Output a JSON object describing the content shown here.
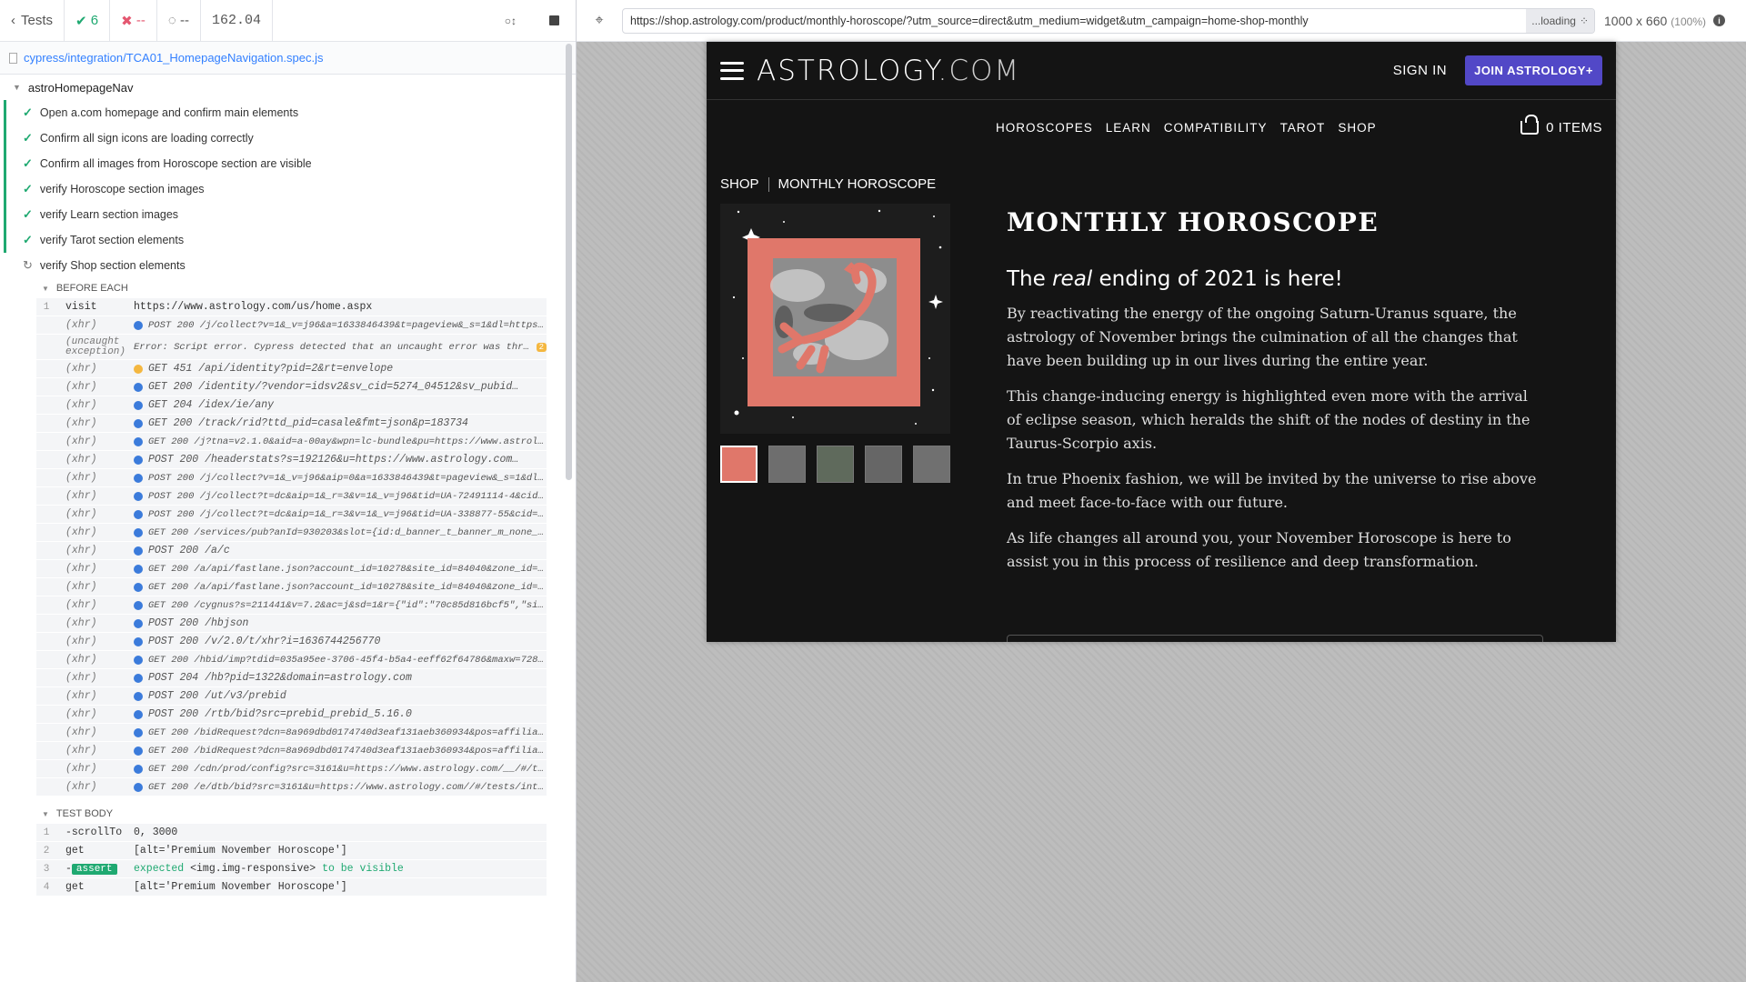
{
  "reporter": {
    "tests_label": "Tests",
    "passed": "6",
    "failed": "--",
    "pending": "--",
    "duration": "162.04",
    "spec_file": "cypress/integration/TCA01_HomepageNavigation.spec.js",
    "suite": "astroHomepageNav",
    "tests": [
      {
        "title": "Open a.com homepage and confirm main elements",
        "state": "passed"
      },
      {
        "title": "Confirm all sign icons are loading correctly",
        "state": "passed"
      },
      {
        "title": "Confirm all images from Horoscope section are visible",
        "state": "passed"
      },
      {
        "title": "verify Horoscope section images",
        "state": "passed"
      },
      {
        "title": "verify Learn section images",
        "state": "passed"
      },
      {
        "title": "verify Tarot section elements",
        "state": "passed"
      },
      {
        "title": "verify Shop section elements",
        "state": "running"
      }
    ],
    "before_each_label": "BEFORE EACH",
    "test_body_label": "TEST BODY",
    "before_each_cmds": [
      {
        "num": "1",
        "name": "visit",
        "msg": "https://www.astrology.com/us/home.aspx",
        "type": "plain"
      },
      {
        "name": "(xhr)",
        "msg": "POST 200 /j/collect?v=1&_v=j96&a=1633846439&t=pageview&_s=1&dl=https:…",
        "type": "small"
      },
      {
        "name": "(uncaught exception)",
        "msg": "Error: Script error. Cypress detected that an uncaught error was throw…",
        "badge": "2",
        "type": "exception"
      },
      {
        "name": "(xhr)",
        "msg": "GET 451 /api/identity?pid=2&rt=envelope",
        "dot": "orange"
      },
      {
        "name": "(xhr)",
        "msg": "GET 200 /identity/?vendor=idsv2&sv_cid=5274_04512&sv_pubid…"
      },
      {
        "name": "(xhr)",
        "msg": "GET 204 /idex/ie/any"
      },
      {
        "name": "(xhr)",
        "msg": "GET 200 /track/rid?ttd_pid=casale&fmt=json&p=183734"
      },
      {
        "name": "(xhr)",
        "msg": "GET 200 /j?tna=v2.1.0&aid=a-00ay&wpn=lc-bundle&pu=https://www.astrolo…",
        "type": "small"
      },
      {
        "name": "(xhr)",
        "msg": "POST 200 /headerstats?s=192126&u=https://www.astrology.com…"
      },
      {
        "name": "(xhr)",
        "msg": "POST 200 /j/collect?v=1&_v=j96&aip=0&a=1633846439&t=pageview&_s=1&dl=…",
        "type": "small"
      },
      {
        "name": "(xhr)",
        "msg": "POST 200 /j/collect?t=dc&aip=1&_r=3&v=1&_v=j96&tid=UA-72491114-4&cid=…",
        "type": "small"
      },
      {
        "name": "(xhr)",
        "msg": "POST 200 /j/collect?t=dc&aip=1&_r=3&v=1&_v=j96&tid=UA-338877-55&cid=1…",
        "type": "small"
      },
      {
        "name": "(xhr)",
        "msg": "GET 200 /services/pub?anId=930203&slot={id:d_banner_t_banner_m_none_1…",
        "type": "small"
      },
      {
        "name": "(xhr)",
        "msg": "POST 200 /a/c"
      },
      {
        "name": "(xhr)",
        "msg": "GET 200 /a/api/fastlane.json?account_id=10278&site_id=84040&zone_id=7…",
        "type": "small"
      },
      {
        "name": "(xhr)",
        "msg": "GET 200 /a/api/fastlane.json?account_id=10278&site_id=84040&zone_id=7…",
        "type": "small"
      },
      {
        "name": "(xhr)",
        "msg": "GET 200 /cygnus?s=211441&v=7.2&ac=j&sd=1&r={\"id\":\"70c85d816bcf5\",\"sit…",
        "type": "small"
      },
      {
        "name": "(xhr)",
        "msg": "POST 200 /hbjson"
      },
      {
        "name": "(xhr)",
        "msg": "POST 200 /v/2.0/t/xhr?i=1636744256770"
      },
      {
        "name": "(xhr)",
        "msg": "GET 200 /hbid/imp?tdid=035a95ee-3706-45f4-b5a4-eeff62f64786&maxw=728…",
        "type": "small"
      },
      {
        "name": "(xhr)",
        "msg": "POST 204 /hb?pid=1322&domain=astrology.com"
      },
      {
        "name": "(xhr)",
        "msg": "POST 200 /ut/v3/prebid"
      },
      {
        "name": "(xhr)",
        "msg": "POST 200 /rtb/bid?src=prebid_prebid_5.16.0"
      },
      {
        "name": "(xhr)",
        "msg": "GET 200 /bidRequest?dcn=8a969dbd0174740d3eaf131aeb360934&pos=affiliat…",
        "type": "small"
      },
      {
        "name": "(xhr)",
        "msg": "GET 200 /bidRequest?dcn=8a969dbd0174740d3eaf131aeb360934&pos=affiliat…",
        "type": "small"
      },
      {
        "name": "(xhr)",
        "msg": "GET 200 /cdn/prod/config?src=3161&u=https://www.astrology.com/__/#/te…",
        "type": "small"
      },
      {
        "name": "(xhr)",
        "msg": "GET 200 /e/dtb/bid?src=3161&u=https://www.astrology.com//#/tests/inte…",
        "type": "small"
      }
    ],
    "test_body_cmds": [
      {
        "num": "1",
        "name": "-scrollTo",
        "msg": "0, 3000"
      },
      {
        "num": "2",
        "name": "get",
        "msg": "[alt='Premium November Horoscope']"
      },
      {
        "num": "3",
        "name": "assert",
        "assert": true,
        "msg_expected": "expected",
        "msg_subject": "<img.img-responsive>",
        "msg_to_be": "to be",
        "msg_visible": "visible"
      },
      {
        "num": "4",
        "name": "get",
        "msg": "[alt='Premium November Horoscope']"
      }
    ]
  },
  "aut": {
    "url": "https://shop.astrology.com/product/monthly-horoscope/?utm_source=direct&utm_medium=widget&utm_campaign=home-shop-monthly",
    "loading_label": "...loading",
    "viewport": "1000 x 660",
    "zoom": "(100%)"
  },
  "site": {
    "logo_main": "ASTROLOGY",
    "logo_tld": ".COM",
    "sign_in": "SIGN IN",
    "join": "JOIN ASTROLOGY+",
    "nav": [
      "HOROSCOPES",
      "LEARN",
      "COMPATIBILITY",
      "TAROT",
      "SHOP"
    ],
    "cart": "0 ITEMS",
    "breadcrumb": [
      "SHOP",
      "MONTHLY HOROSCOPE"
    ],
    "product_title": "MONTHLY HOROSCOPE",
    "tagline_pre": "The",
    "tagline_em": "real",
    "tagline_post": "ending of 2021 is here!",
    "paragraphs": [
      "By reactivating the energy of the ongoing Saturn-Uranus square, the astrology of November brings the culmination of all the changes that have been building up in our lives during the entire year.",
      "This change-inducing energy is highlighted even more with the arrival of eclipse season, which heralds the shift of the nodes of destiny in the Taurus-Scorpio axis.",
      "In true Phoenix fashion, we will be invited by the universe to rise above and meet face-to-face with our future.",
      "As life changes all around you, your November Horoscope is here to assist you in this process of resilience and deep transformation."
    ],
    "colors": {
      "accent": "#5248c7",
      "bg": "#141414",
      "product_pink": "#e0776a"
    }
  }
}
